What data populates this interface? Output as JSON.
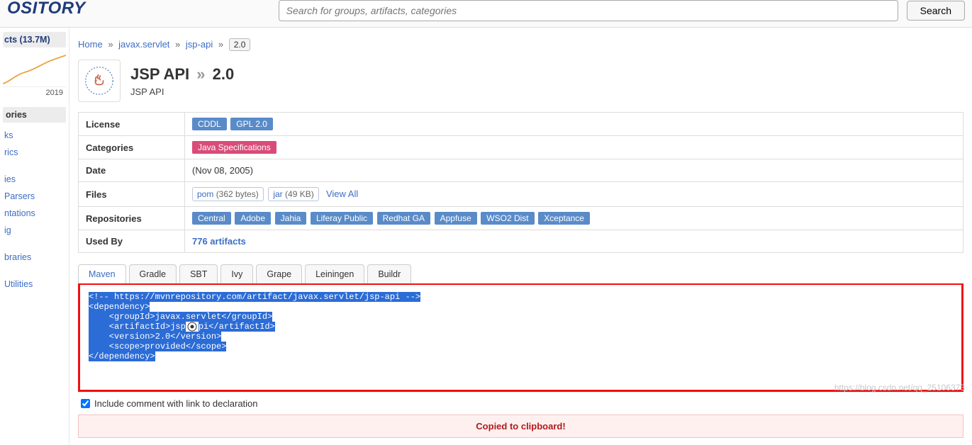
{
  "logo": "OSITORY",
  "search": {
    "placeholder": "Search for groups, artifacts, categories",
    "button": "Search"
  },
  "sidebar": {
    "stat": "cts (13.7M)",
    "year": "2019",
    "group_head": "ories",
    "items": [
      "ks",
      "rics",
      "",
      "ies",
      "Parsers",
      "ntations",
      "ig",
      "",
      "braries",
      "",
      "Utilities"
    ]
  },
  "breadcrumb": {
    "home": "Home",
    "a": "javax.servlet",
    "b": "jsp-api",
    "ver": "2.0"
  },
  "heading": {
    "title_a": "JSP API",
    "title_b": "2.0",
    "subtitle": "JSP API"
  },
  "meta": {
    "rows": {
      "license": {
        "label": "License"
      },
      "categories": {
        "label": "Categories"
      },
      "date": {
        "label": "Date"
      },
      "files": {
        "label": "Files"
      },
      "repositories": {
        "label": "Repositories"
      },
      "usedby": {
        "label": "Used By"
      }
    },
    "license": [
      "CDDL",
      "GPL 2.0"
    ],
    "categories": [
      "Java Specifications"
    ],
    "date": "(Nov 08, 2005)",
    "files": {
      "pom": "pom",
      "pom_size": "(362 bytes)",
      "jar": "jar",
      "jar_size": "(49 KB)",
      "viewall": "View All"
    },
    "repositories": [
      "Central",
      "Adobe",
      "Jahia",
      "Liferay Public",
      "Redhat GA",
      "Appfuse",
      "WSO2 Dist",
      "Xceptance"
    ],
    "usedby": "776 artifacts"
  },
  "tabs": [
    "Maven",
    "Gradle",
    "SBT",
    "Ivy",
    "Grape",
    "Leiningen",
    "Buildr"
  ],
  "code": {
    "l1": "<!-- https://mvnrepository.com/artifact/javax.servlet/jsp-api -->",
    "l2": "<dependency>",
    "l3a": "    <groupId>javax.servlet</groupId>",
    "l4a": "    <artifactId>jsp",
    "l4b": "pi</artifactId>",
    "l5": "    <version>2.0</version>",
    "l6": "    <scope>provided</scope>",
    "l7": "</dependency>"
  },
  "include": {
    "label": "Include comment with link to declaration"
  },
  "copied": "Copied to clipboard!",
  "watermark": "https://blog.csdn.net/qq_25106373"
}
